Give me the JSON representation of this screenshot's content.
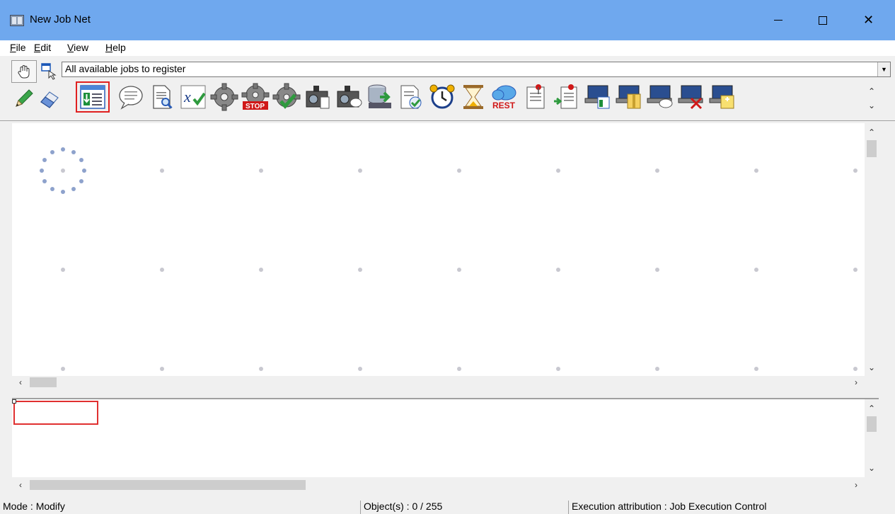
{
  "window": {
    "title": "New Job Net"
  },
  "menu": {
    "items": [
      {
        "label": "File",
        "accel": "F",
        "rest": "ile"
      },
      {
        "label": "Edit",
        "accel": "E",
        "rest": "dit"
      },
      {
        "label": "View",
        "accel": "V",
        "rest": "iew"
      },
      {
        "label": "Help",
        "accel": "H",
        "rest": "elp"
      }
    ]
  },
  "toolbar": {
    "job_filter_value": "All available jobs to register",
    "mode_icons": [
      "hand-icon",
      "pointer-window-icon",
      "pencil-icon",
      "eraser-icon"
    ],
    "palette_icons": [
      "transfer-job-icon",
      "comment-icon",
      "document-search-icon",
      "variable-check-icon",
      "gear-icon",
      "gear-stop-icon",
      "gear-check-icon",
      "camera-document-icon",
      "camera-message-icon",
      "database-download-icon",
      "document-check-icon",
      "alarm-clock-icon",
      "hourglass-icon",
      "rest-cloud-icon",
      "flag-document-icon",
      "flag-document-arrow-icon",
      "computer-transfer-icon",
      "computer-archive-icon",
      "computer-message-icon",
      "computer-delete-icon",
      "computer-new-icon"
    ],
    "palette_rest_label": "REST",
    "palette_stop_label": "STOP"
  },
  "status": {
    "mode": "Mode : Modify",
    "objects": "Object(s) : 0 / 255",
    "execution": "Execution attribution : Job Execution Control"
  },
  "colors": {
    "titlebar": "#6fa8ee",
    "selection": "#e02020"
  }
}
